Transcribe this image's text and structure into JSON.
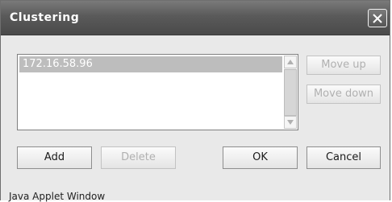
{
  "window": {
    "title": "Clustering",
    "status_text": "Java Applet Window"
  },
  "list": {
    "items": [
      "172.16.58.96"
    ],
    "selected_index": 0
  },
  "buttons": {
    "move_up": "Move up",
    "move_down": "Move down",
    "add": "Add",
    "delete": "Delete",
    "ok": "OK",
    "cancel": "Cancel"
  },
  "icons": {
    "close": "close-icon",
    "scroll_up": "arrow-up-icon",
    "scroll_down": "arrow-down-icon"
  }
}
